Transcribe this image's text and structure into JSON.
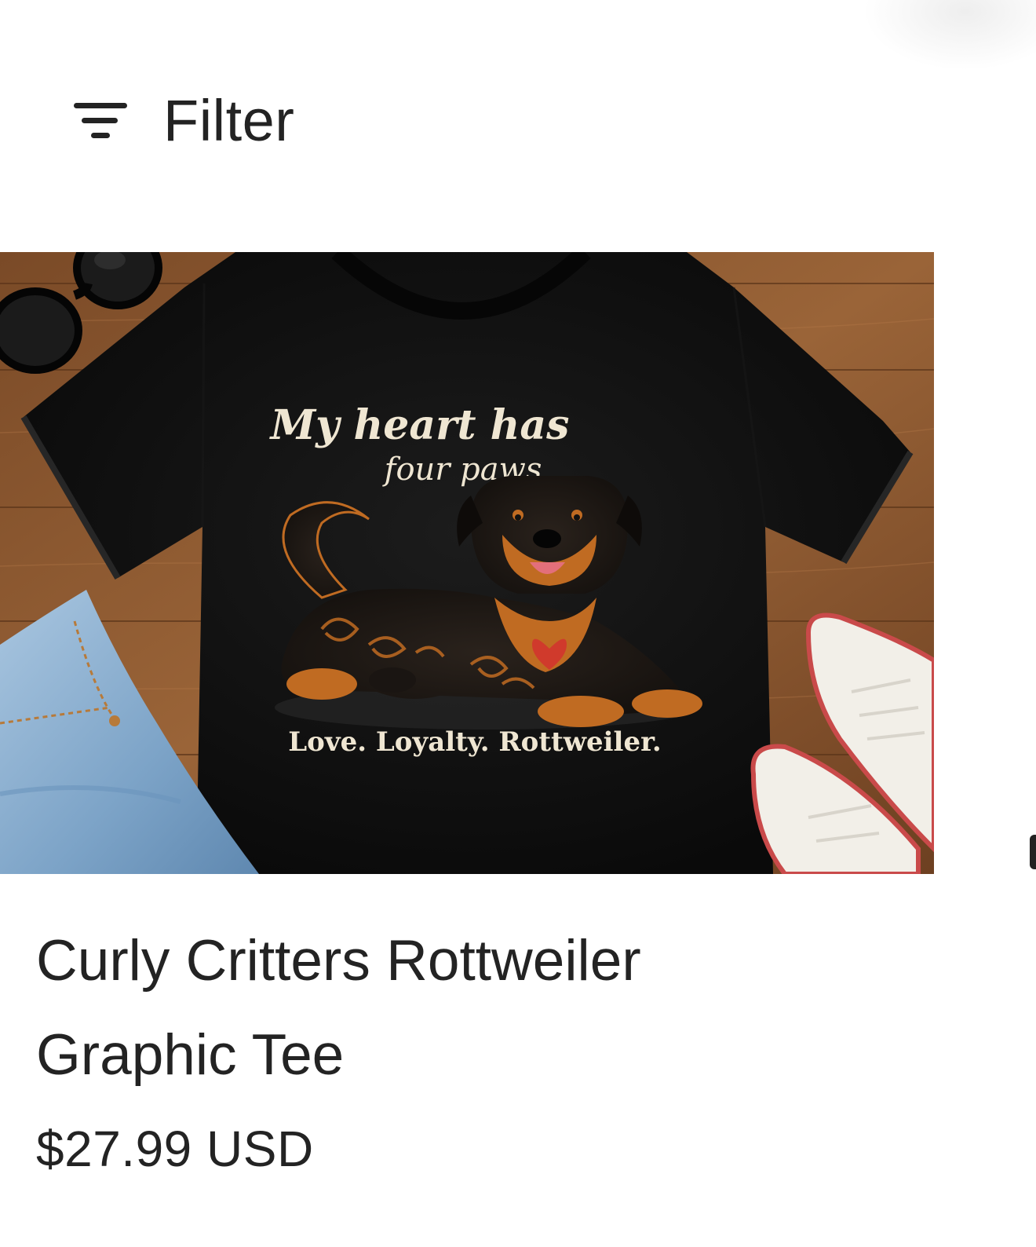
{
  "filter": {
    "label": "Filter",
    "icon": "filter-lines-icon"
  },
  "product": {
    "title": "Curly Critters Rottweiler Graphic Tee",
    "price": "$27.99 USD",
    "image": {
      "shirt_text_line1": "My heart has",
      "shirt_text_line2": "four paws",
      "shirt_tagline": "Love. Loyalty. Rottweiler."
    }
  },
  "colors": {
    "text": "#232323",
    "wood": "#8a5a33",
    "shirt": "#111111",
    "denim": "#7ea7cc",
    "print_cream": "#efe6d2",
    "dog_tan": "#c06b22"
  }
}
